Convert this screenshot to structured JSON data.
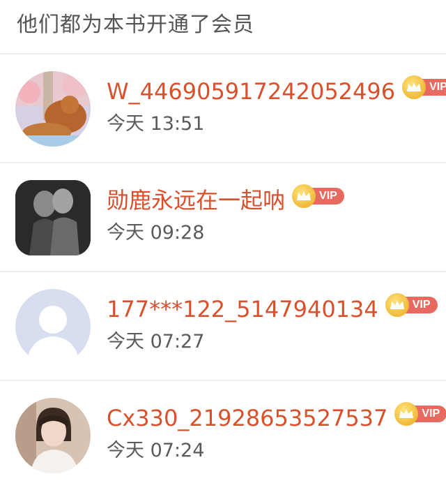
{
  "header": {
    "title": "他们都为本书开通了会员"
  },
  "members": [
    {
      "name": "W_446905917242052496",
      "vip_label": "VIP",
      "time": "今天 13:51"
    },
    {
      "name": "勋鹿永远在一起呐",
      "vip_label": "VIP",
      "time": "今天 09:28"
    },
    {
      "name": "177***122_5147940134",
      "vip_label": "VIP",
      "time": "今天 07:27"
    },
    {
      "name": "Cx330_21928653527537",
      "vip_label": "VIP",
      "time": "今天 07:24"
    }
  ],
  "colors": {
    "name": "#d9512c",
    "vip_badge": "#e66a5f",
    "divider": "#ececec"
  }
}
